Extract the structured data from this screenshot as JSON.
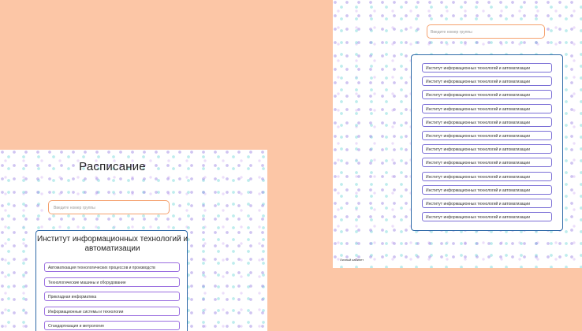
{
  "left_screen": {
    "title": "Расписание",
    "search_placeholder": "Введите номер группы",
    "institute_title": "Институт информационных технологий и автоматизации",
    "directions": [
      "Автоматизация технологических процессов и производств",
      "Технологические машины и оборудование",
      "Прикладная информатика",
      "Информационные системы и технологии",
      "Стандартизация и метрология"
    ]
  },
  "right_screen": {
    "search_placeholder": "Введите номер группы",
    "institutes": [
      "Институт информационных технологий и автоматизации",
      "Институт информационных технологий и автоматизации",
      "Институт информационных технологий и автоматизации",
      "Институт информационных технологий и автоматизации",
      "Институт информационных технологий и автоматизации",
      "Институт информационных технологий и автоматизации",
      "Институт информационных технологий и автоматизации",
      "Институт информационных технологий и автоматизации",
      "Институт информационных технологий и автоматизации",
      "Институт информационных технологий и автоматизации",
      "Институт информационных технологий и автоматизации",
      "Институт информационных технологий и автоматизации"
    ],
    "account_link": "Личный кабинет"
  },
  "colors": {
    "background": "#fcc6a6",
    "search_border": "#f5a26f",
    "panel_border": "#2f6aa8",
    "item_border": "#9b6fe0"
  }
}
